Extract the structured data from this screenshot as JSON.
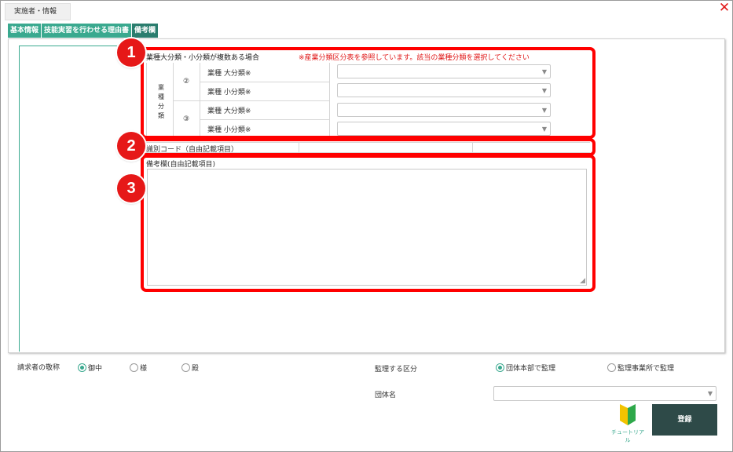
{
  "window": {
    "title": "実施者・情報",
    "close_glyph": "✕",
    "close_icon": "close-icon"
  },
  "tabs": [
    {
      "label": "基本情報",
      "active": false
    },
    {
      "label": "技能実習を行わせる理由書",
      "active": false
    },
    {
      "label": "備考欄",
      "active": true
    }
  ],
  "section1": {
    "title": "業種大分類・小分類が複数ある場合",
    "note": "※産業分類区分表を参照しています。該当の業種分類を選択してください",
    "group_label_chars": [
      "業",
      "種",
      "分",
      "類"
    ],
    "groups": [
      {
        "number": "②",
        "rows": [
          {
            "label": "業種 大分類※",
            "value": ""
          },
          {
            "label": "業種 小分類※",
            "value": ""
          }
        ]
      },
      {
        "number": "③",
        "rows": [
          {
            "label": "業種 大分類※",
            "value": ""
          },
          {
            "label": "業種 小分類※",
            "value": ""
          }
        ]
      }
    ]
  },
  "section2": {
    "label": "識別コード（自由記載項目）"
  },
  "section3": {
    "label": "備考欄(自由記載項目)",
    "value": ""
  },
  "markers": [
    "1",
    "2",
    "3"
  ],
  "highlight_color": "#ff0000",
  "marker_color": "#e61818",
  "footer": {
    "billing_label": "請求者の敬称",
    "billing_options": [
      {
        "label": "御中",
        "selected": true
      },
      {
        "label": "様",
        "selected": false
      },
      {
        "label": "殿",
        "selected": false
      }
    ],
    "supervision_label": "監理する区分",
    "supervision_options": [
      {
        "label": "団体本部で監理",
        "selected": true
      },
      {
        "label": "監理事業所で監理",
        "selected": false
      }
    ],
    "org_name_label": "団体名",
    "org_name_value": "",
    "tutorial_label": "チュートリアル",
    "tutorial_icon": "beginner-mark-icon",
    "register_label": "登録"
  },
  "colors": {
    "accent": "#3aa98f",
    "tab_active": "#2a7d6e",
    "register_bg": "#2e4a48",
    "note_red": "#e01818"
  }
}
